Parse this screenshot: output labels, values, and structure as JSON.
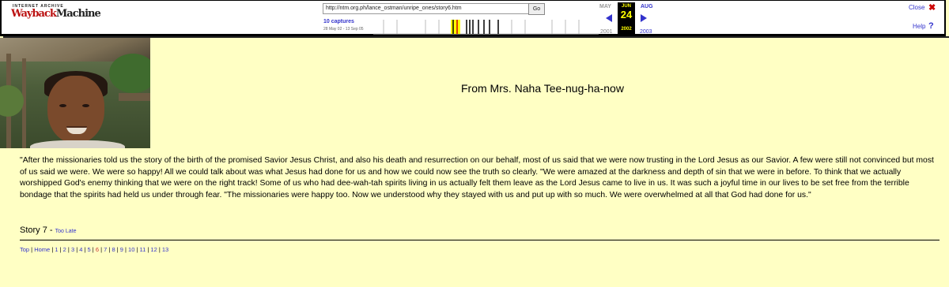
{
  "wayback": {
    "logo_top": "INTERNET ARCHIVE",
    "logo_main_1": "Wayback",
    "logo_main_2": "Machine",
    "url": "http://ntm.org.ph/lance_ostman/unripe_ones/story6.htm",
    "go_label": "Go",
    "captures": "10 captures",
    "capture_range": "28 May 02 - 13 Sep 05",
    "prev_month": "MAY",
    "current_month": "JUN",
    "current_day": "24",
    "current_year": "2002",
    "next_month": "AUG",
    "prev_year": "2001",
    "next_year": "2003",
    "close_label": "Close",
    "help_label": "Help",
    "close_icon": "close-x-icon",
    "help_icon": "question-icon"
  },
  "page": {
    "heading": "From Mrs. Naha Tee-nug-ha-now",
    "body": "\"After the missionaries told us the story of the birth of the promised Savior Jesus Christ, and also his death and resurrection on our behalf, most of us said that we were now trusting in the Lord Jesus as our Savior. A few were still not convinced but most of us said we were. We were so happy! All we could talk about was what Jesus had done for us and how we could now see the truth so clearly. \"We were amazed at the darkness and depth of sin that we were in before. To think that we actually worshipped God's enemy thinking that we were on the right track! Some of us who had dee-wah-tah spirits living in us actually felt them leave as the Lord Jesus came to live in us. It was such a joyful time in our lives to be set free from the terrible bondage that the spirits had held us under through fear. \"The missionaries were happy too. Now we understood why they stayed with us and put up with so much. We were overwhelmed at all that God had done for us.\"",
    "story_label": "Story 7 - ",
    "story_link": "Too Late"
  },
  "footer": {
    "top": "Top",
    "home": "Home",
    "pages": [
      "1",
      "2",
      "3",
      "4",
      "5",
      "6",
      "7",
      "8",
      "9",
      "10",
      "11",
      "12",
      "13"
    ]
  }
}
